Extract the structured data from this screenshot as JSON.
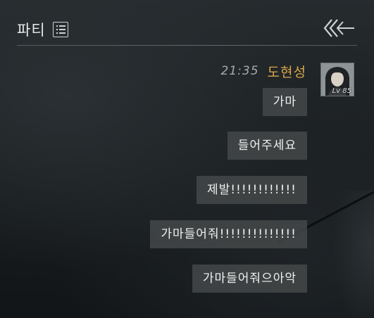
{
  "header": {
    "title": "파티",
    "list_icon": "list-icon",
    "back_icon": "back-arrow-icon"
  },
  "message_group": {
    "time": "21:35",
    "sender": "도현성",
    "sender_color": "#d8a64a",
    "avatar_level": "Lv 85",
    "messages": [
      "가마",
      "들어주세요",
      "제발!!!!!!!!!!!!",
      "가마들어줘!!!!!!!!!!!!!!",
      "가마들어줘으아악"
    ]
  }
}
